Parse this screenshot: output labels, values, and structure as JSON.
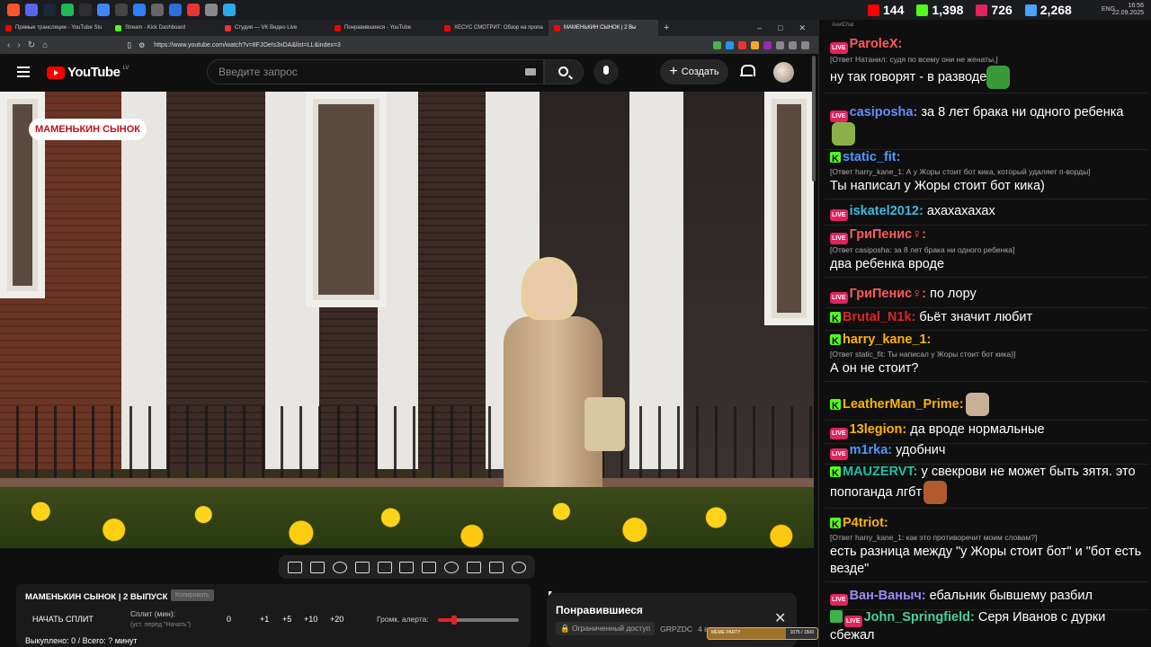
{
  "taskbar": {
    "icons": [
      {
        "name": "brave-icon",
        "color": "#fb542b"
      },
      {
        "name": "discord-icon",
        "color": "#5865f2"
      },
      {
        "name": "steam-icon",
        "color": "#1b2838"
      },
      {
        "name": "spotify-icon",
        "color": "#1db954"
      },
      {
        "name": "obs-icon",
        "color": "#302e31"
      },
      {
        "name": "chrome-icon",
        "color": "#4285f4"
      },
      {
        "name": "app-icon",
        "color": "#444"
      },
      {
        "name": "app2-icon",
        "color": "#2d7ff9"
      },
      {
        "name": "app3-icon",
        "color": "#666"
      },
      {
        "name": "app4-icon",
        "color": "#2a6fdb"
      },
      {
        "name": "app5-icon",
        "color": "#e33"
      },
      {
        "name": "app6-icon",
        "color": "#888"
      },
      {
        "name": "telegram-icon",
        "color": "#2aabee"
      }
    ],
    "stats": [
      {
        "name": "youtube-live-count",
        "value": "144",
        "color": "#f00"
      },
      {
        "name": "kick-count",
        "value": "1,398",
        "color": "#53fc18"
      },
      {
        "name": "vk-live-count",
        "value": "726",
        "color": "#e0245e"
      },
      {
        "name": "total-viewers",
        "value": "2,268",
        "color": "#4aa3ff"
      }
    ],
    "lang": "ENG",
    "time": "16:56",
    "date": "22.09.2025"
  },
  "browser": {
    "tabs": [
      {
        "label": "Прямые трансляции - YouTube Stu",
        "fav": "#f00"
      },
      {
        "label": "Stream - Kick Dashboard",
        "fav": "#53fc18"
      },
      {
        "label": "Студия — VK Видео Live",
        "fav": "#e33"
      },
      {
        "label": "Понравившиеся - YouTube",
        "fav": "#f00"
      },
      {
        "label": "ХЕСУС СМОТРИТ: Обзор на пропа",
        "fav": "#f00"
      },
      {
        "label": "МАМЕНЬКИН СЫНОК | 2 Вы",
        "fav": "#f00",
        "active": true
      }
    ],
    "url": "https://www.youtube.com/watch?v=8FJOeIs3xDA&list=LL&index=3"
  },
  "youtube": {
    "logo": "YouTube",
    "region": "LV",
    "search_placeholder": "Введите запрос",
    "create_label": "Создать",
    "badge": "МАМЕНЬКИН СЫНОК"
  },
  "split_panel": {
    "title": "МАМЕНЬКИН СЫНОК | 2 ВЫПУСК",
    "copy_label": "Копировать",
    "start_label": "НАЧАТЬ СПЛИТ",
    "split_label": "Сплит (мин):",
    "split_hint": "(уст. перед \"Начать\")",
    "split_value": "0",
    "increments": [
      "+1",
      "+5",
      "+10",
      "+20"
    ],
    "volume_label": "Громк. алерта:",
    "volume_fraction": 0.2,
    "summary": "Выкуплено: 0 / Всего: ? минут"
  },
  "liked_panel": {
    "title": "Понравившиеся",
    "access": "Ограниченный доступ",
    "owner": "GRPZDC",
    "count": "4 ви"
  },
  "meme_bar": {
    "label": "MEME PARTY",
    "progress_text": "1075 / 1500",
    "fraction": 0.7167
  },
  "chat": {
    "title": "AxelChat",
    "messages": [
      {
        "platform": "live",
        "user": "ParoleX:",
        "color": "#ff5a5a",
        "reply": "[Ответ Натанил: судя по всему они не женаты,]",
        "text": "ну так говорят - в разводе",
        "emote": "#3a9a3a"
      },
      {
        "platform": "live",
        "user": "casiposha:",
        "color": "#6a8cff",
        "reply": "",
        "text": "за 8 лет брака ни одного ребенка",
        "emote": "#8ab04a"
      },
      {
        "platform": "kick",
        "user": "static_fit:",
        "color": "#4a9aff",
        "reply": "[Ответ harry_kane_1: А у Жоры стоит бот кика, который удаляет п-ворды]",
        "text": "Ты написал у Жоры стоит бот кика)",
        "emote": ""
      },
      {
        "platform": "live",
        "user": "iskatel2012:",
        "color": "#3fb7e0",
        "reply": "",
        "text": "ахахахахах",
        "emote": ""
      },
      {
        "platform": "live",
        "user": "ГриПенис♀:",
        "color": "#ff5a5a",
        "reply": "[Ответ casiposha: за 8 лет брака ни одного ребенка]",
        "text": "два ребенка вроде",
        "emote": ""
      },
      {
        "platform": "live",
        "user": "ГриПенис♀:",
        "color": "#ff5a5a",
        "reply": "",
        "text": "по лору",
        "emote": ""
      },
      {
        "platform": "kick",
        "user": "Brutal_N1k:",
        "color": "#e02424",
        "reply": "",
        "text": "бьёт значит любит",
        "emote": ""
      },
      {
        "platform": "kick",
        "user": "harry_kane_1:",
        "color": "#ffb400",
        "reply": "[Ответ static_fit: Ты написал у Жоры стоит бот кика)]",
        "text": "А он не стоит?",
        "emote": ""
      },
      {
        "platform": "kick",
        "user": "LeatherMan_Prime:",
        "color": "#ffb400",
        "reply": "",
        "text": "",
        "emote": "#c8b098"
      },
      {
        "platform": "live",
        "user": "13legion:",
        "color": "#ffb400",
        "reply": "",
        "text": "да вроде нормальные",
        "emote": ""
      },
      {
        "platform": "live",
        "user": "m1rka:",
        "color": "#4a9aff",
        "reply": "",
        "text": "удобнич",
        "emote": ""
      },
      {
        "platform": "kick",
        "user": "MAUZERVT:",
        "color": "#20c0a0",
        "reply": "",
        "text": "у свекрови не может быть зятя. это попоганда лгбт",
        "emote": "#b05a30"
      },
      {
        "platform": "kick",
        "user": "P4triot:",
        "color": "#ffb400",
        "reply": "[Ответ harry_kane_1: как это противоречит моим словам?]",
        "text": "есть разница между \"у Жоры стоит бот\" и \"бот есть везде\"",
        "emote": ""
      },
      {
        "platform": "live",
        "user": "Ван-Ваныч:",
        "color": "#9a8aff",
        "reply": "",
        "text": "ебальник бывшему разбил",
        "emote": ""
      },
      {
        "platform": "live",
        "user": "John_Springfield:",
        "color": "#4ad0a0",
        "reply": "",
        "text": "Серя Иванов с дурки сбежал",
        "emote": "",
        "check": true
      }
    ]
  }
}
